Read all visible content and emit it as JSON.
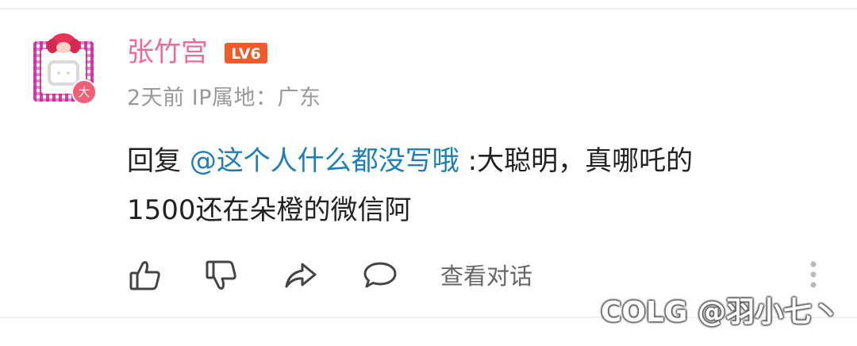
{
  "comment": {
    "username": "张竹宫",
    "level": "LV6",
    "avatar_badge": "大",
    "time": "2天前",
    "ip_location": "IP属地：广东",
    "reply_prefix": "回复",
    "mention": "@这个人什么都没写哦",
    "text_line1": " :大聪明，真哪吒的",
    "text_line2": "1500还在朵橙的微信阿"
  },
  "actions": {
    "like_icon": "thumbs-up-icon",
    "dislike_icon": "thumbs-down-icon",
    "share_icon": "share-icon",
    "reply_icon": "speech-bubble-icon",
    "view_conversation_label": "查看对话",
    "more_icon": "more-vertical-icon"
  },
  "watermark": "COLG @羽小七丶",
  "colors": {
    "username": "#f06a96",
    "level_badge": "#f25a2a",
    "mention": "#1e7fb5",
    "meta": "#999999",
    "text": "#222222"
  }
}
